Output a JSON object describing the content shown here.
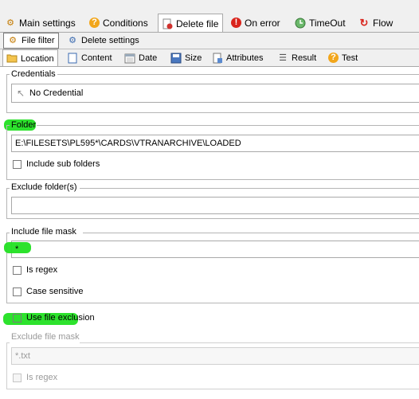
{
  "tabs_main": [
    {
      "label": "Main settings",
      "icon": "gear-icon"
    },
    {
      "label": "Conditions",
      "icon": "question-icon"
    },
    {
      "label": "Delete file",
      "icon": "delete-file-icon"
    },
    {
      "label": "On error",
      "icon": "error-icon"
    },
    {
      "label": "TimeOut",
      "icon": "timeout-icon"
    },
    {
      "label": "Flow",
      "icon": "flow-icon"
    }
  ],
  "tabs_sub": [
    {
      "label": "File filter",
      "icon": "file-filter-icon"
    },
    {
      "label": "Delete settings",
      "icon": "gear-icon"
    }
  ],
  "tabs_filter": [
    {
      "label": "Location",
      "icon": "folder-icon"
    },
    {
      "label": "Content",
      "icon": "document-icon"
    },
    {
      "label": "Date",
      "icon": "calendar-icon"
    },
    {
      "label": "Size",
      "icon": "disk-icon"
    },
    {
      "label": "Attributes",
      "icon": "attributes-icon"
    },
    {
      "label": "Result",
      "icon": "list-icon"
    },
    {
      "label": "Test",
      "icon": "question-icon"
    }
  ],
  "credentials": {
    "label": "Credentials",
    "value": "No Credential",
    "icon": "cursor-icon"
  },
  "folder": {
    "label": "Folder",
    "value": "E:\\FILESETS\\PL595*\\CARDS\\VTRANARCHIVE\\LOADED",
    "include_sub_label": "Include sub folders"
  },
  "exclude_folders": {
    "label": "Exclude folder(s)",
    "value": ""
  },
  "include_mask": {
    "label": "Include file mask",
    "value": "*",
    "is_regex_label": "Is regex",
    "case_sensitive_label": "Case sensitive"
  },
  "use_exclusion_label": "Use file exclusion",
  "exclude_mask": {
    "label": "Exclude file mask",
    "placeholder": "*.txt",
    "is_regex_label": "Is regex"
  },
  "colors": {
    "highlight": "#22e022"
  }
}
